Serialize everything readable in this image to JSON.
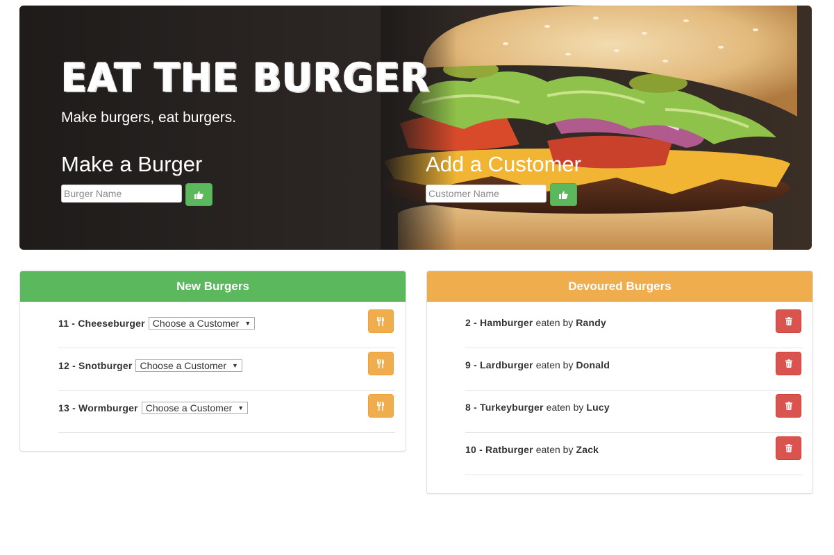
{
  "hero": {
    "title": "EAT THE BURGER",
    "subtitle": "Make burgers, eat burgers.",
    "make_burger": {
      "heading": "Make a Burger",
      "placeholder": "Burger Name",
      "icon": "thumbs-up-icon"
    },
    "add_customer": {
      "heading": "Add a Customer",
      "placeholder": "Customer Name",
      "icon": "thumbs-up-icon"
    }
  },
  "new_burgers": {
    "title": "New Burgers",
    "header_color": "#5cb85c",
    "select_default": "Choose a Customer",
    "action_icon": "cutlery-icon",
    "items": [
      {
        "id": "11",
        "name": "Cheeseburger"
      },
      {
        "id": "12",
        "name": "Snotburger"
      },
      {
        "id": "13",
        "name": "Wormburger"
      }
    ]
  },
  "devoured_burgers": {
    "title": "Devoured Burgers",
    "header_color": "#f0ad4e",
    "eaten_by_label": "eaten by",
    "action_icon": "trash-icon",
    "items": [
      {
        "id": "2",
        "name": "Hamburger",
        "customer": "Randy"
      },
      {
        "id": "9",
        "name": "Lardburger",
        "customer": "Donald"
      },
      {
        "id": "8",
        "name": "Turkeyburger",
        "customer": "Lucy"
      },
      {
        "id": "10",
        "name": "Ratburger",
        "customer": "Zack"
      }
    ]
  }
}
